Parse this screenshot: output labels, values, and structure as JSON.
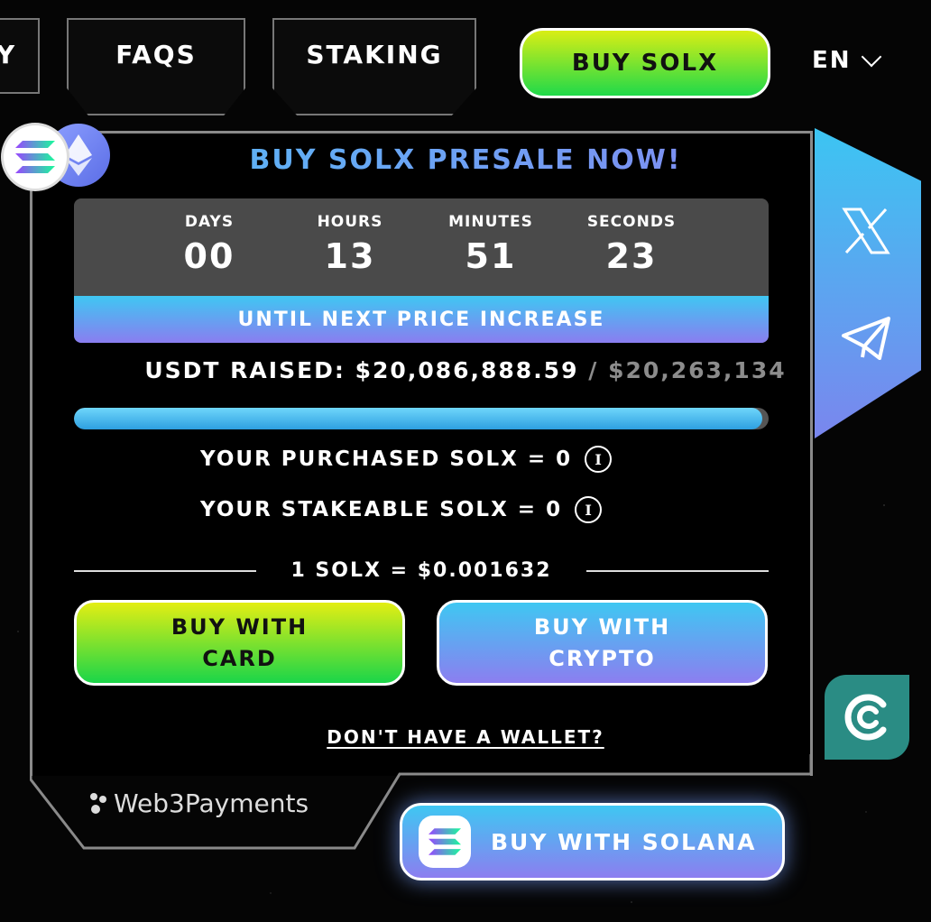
{
  "nav": {
    "partial_tab": "Y",
    "faqs": "FAQS",
    "staking": "STAKING",
    "buy_button": "BUY SOLX",
    "language": "EN"
  },
  "presale": {
    "title": "BUY SOLX PRESALE NOW!",
    "timer": {
      "units": [
        {
          "label": "DAYS",
          "value": "00"
        },
        {
          "label": "HOURS",
          "value": "13"
        },
        {
          "label": "MINUTES",
          "value": "51"
        },
        {
          "label": "SECONDS",
          "value": "23"
        }
      ],
      "band": "UNTIL NEXT PRICE INCREASE"
    },
    "raised_label": "USDT RAISED:",
    "raised_value": "$20,086,888.59",
    "separator": "/",
    "goal": "$20,263,134",
    "progress_fraction": 0.991,
    "purchased": "YOUR PURCHASED SOLX = 0",
    "stakeable": "YOUR STAKEABLE SOLX = 0",
    "info_icon": "i",
    "price": "1 SOLX = $0.001632",
    "buy_card_line1": "BUY WITH",
    "buy_card_line2": "CARD",
    "buy_crypto_line1": "BUY WITH",
    "buy_crypto_line2": "CRYPTO",
    "wallet_link": "DON'T HAVE A WALLET?"
  },
  "footer": {
    "provider": "Web3Payments",
    "buy_solana": "BUY WITH SOLANA"
  },
  "icons": [
    "solana-logo-icon",
    "ethereum-logo-icon",
    "x-twitter-icon",
    "telegram-icon",
    "coin-chat-icon",
    "info-icon"
  ],
  "colors": {
    "green_button": "#1fd94a",
    "lime_button": "#d9ee14",
    "blue_accent": "#3fc7f2",
    "purple_accent": "#8c7ef0",
    "coin_badge": "#2a8c84"
  }
}
